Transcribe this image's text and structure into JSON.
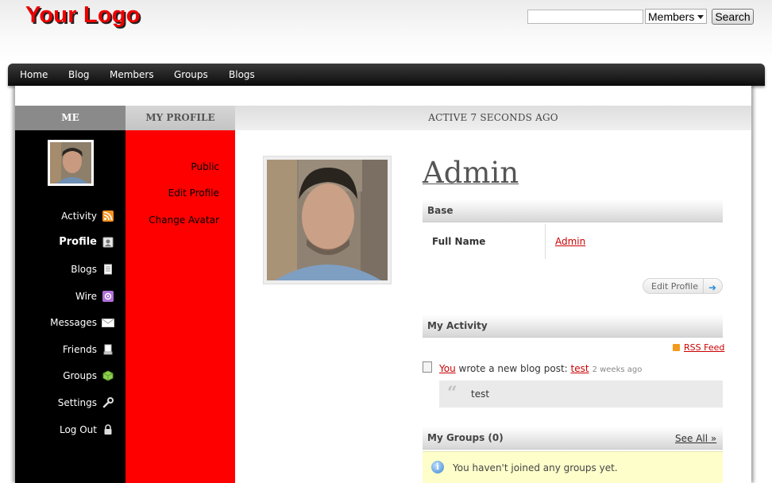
{
  "header": {
    "logo": "Your Logo",
    "search": {
      "placeholder": "",
      "scope_selected": "Members",
      "button": "Search"
    }
  },
  "nav": [
    "Home",
    "Blog",
    "Members",
    "Groups",
    "Blogs"
  ],
  "tabs": {
    "me": "ME",
    "my_profile": "MY PROFILE",
    "active": "ACTIVE 7 SECONDS AGO"
  },
  "me_menu": [
    {
      "label": "Activity",
      "icon": "rss-icon"
    },
    {
      "label": "Profile",
      "icon": "profile-icon"
    },
    {
      "label": "Blogs",
      "icon": "document-icon"
    },
    {
      "label": "Wire",
      "icon": "wire-icon"
    },
    {
      "label": "Messages",
      "icon": "envelope-icon"
    },
    {
      "label": "Friends",
      "icon": "friends-icon"
    },
    {
      "label": "Groups",
      "icon": "cube-icon"
    },
    {
      "label": "Settings",
      "icon": "wrench-icon"
    },
    {
      "label": "Log Out",
      "icon": "lock-icon"
    }
  ],
  "profile_menu": [
    "Public",
    "Edit Profile",
    "Change Avatar"
  ],
  "profile": {
    "name": "Admin",
    "base_heading": "Base",
    "full_name_label": "Full Name",
    "full_name_value": "Admin",
    "edit_button": "Edit Profile"
  },
  "activity": {
    "heading": "My Activity",
    "rss": "RSS Feed",
    "item": {
      "actor": "You",
      "text": " wrote a new blog post: ",
      "post": "test",
      "time": "2 weeks ago",
      "excerpt": "test"
    }
  },
  "groups": {
    "heading": "My Groups (0)",
    "see_all": "See All »",
    "empty": "You haven't joined any groups yet."
  },
  "colors": {
    "logo": "#ee0000",
    "profile_column": "#ff0000",
    "me_column": "#000000",
    "link": "#cc0000"
  }
}
